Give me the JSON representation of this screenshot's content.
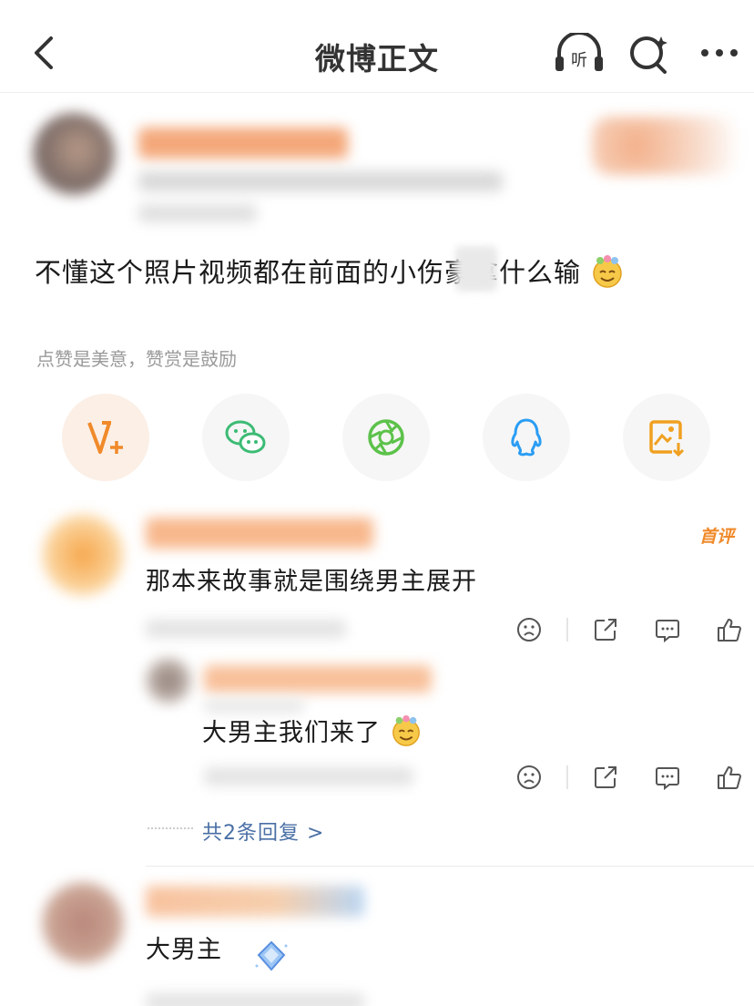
{
  "header": {
    "title": "微博正文",
    "listen_label": "听"
  },
  "post": {
    "text": "不懂这个照片视频都在前面的小伤",
    "text_tail": "豪拿什么输",
    "hint": "点赞是美意，赞赏是鼓励"
  },
  "share": {
    "items": [
      "vplus-icon",
      "wechat-icon",
      "moments-icon",
      "qq-icon",
      "save-image-icon"
    ]
  },
  "comments": [
    {
      "badge": "首评",
      "text": "那本来故事就是围绕男主展开",
      "reply": {
        "text": "大男主我们来了"
      },
      "reply_link": "共2条回复 >"
    },
    {
      "text": "大男主"
    }
  ],
  "colors": {
    "accent": "#f08a2a",
    "link": "#4a6fa5"
  }
}
